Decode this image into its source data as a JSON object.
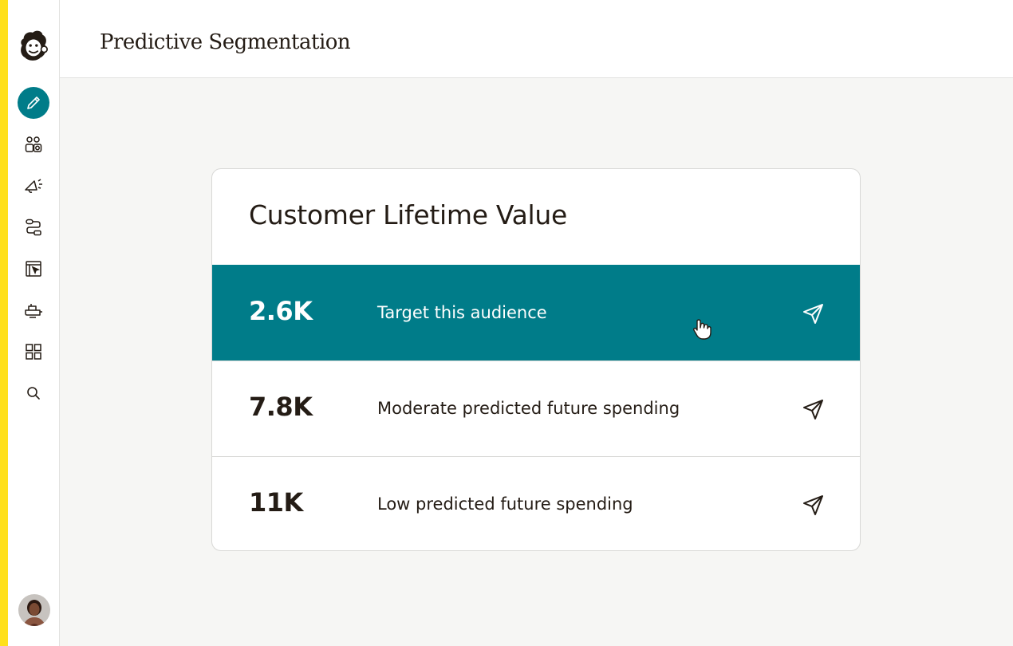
{
  "header": {
    "title": "Predictive Segmentation"
  },
  "sidebar": {
    "items": [
      {
        "name": "create",
        "icon": "pencil-icon",
        "active": true
      },
      {
        "name": "audience",
        "icon": "audience-icon",
        "active": false
      },
      {
        "name": "campaigns",
        "icon": "megaphone-icon",
        "active": false
      },
      {
        "name": "automations",
        "icon": "automation-flow-icon",
        "active": false
      },
      {
        "name": "website",
        "icon": "website-cursor-icon",
        "active": false
      },
      {
        "name": "integrations",
        "icon": "integrations-icon",
        "active": false
      },
      {
        "name": "content",
        "icon": "grid-icon",
        "active": false
      },
      {
        "name": "search",
        "icon": "search-icon",
        "active": false
      }
    ]
  },
  "card": {
    "title": "Customer Lifetime Value",
    "segments": [
      {
        "value": "2.6K",
        "label": "Target this audience",
        "highlighted": true
      },
      {
        "value": "7.8K",
        "label": "Moderate predicted future spending",
        "highlighted": false
      },
      {
        "value": "11K",
        "label": "Low predicted future spending",
        "highlighted": false
      }
    ]
  },
  "colors": {
    "accent": "#007c89",
    "brand_yellow": "#ffe01b",
    "text": "#241c15",
    "background": "#f6f6f4"
  }
}
